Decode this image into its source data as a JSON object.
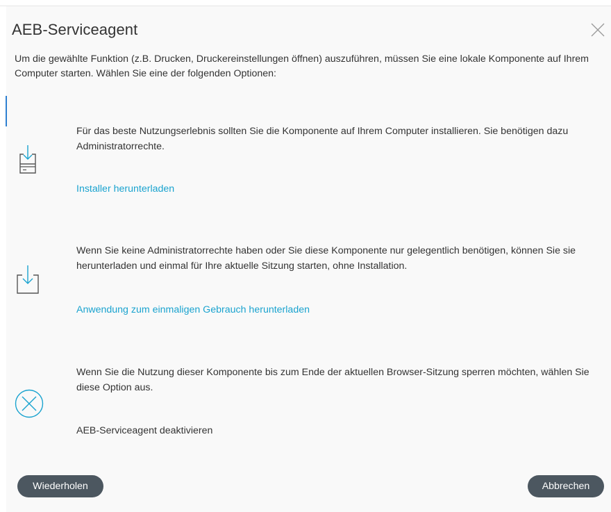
{
  "dialog": {
    "title": "AEB-Serviceagent",
    "intro": "Um die gewählte Funktion (z.B. Drucken, Druckereinstellungen öffnen) auszuführen, müssen Sie eine lokale Komponente auf Ihrem Computer starten. Wählen Sie eine der folgenden Optionen:"
  },
  "options": [
    {
      "icon": "install-disk-icon",
      "text": "Für das beste Nutzungserlebnis sollten Sie die Komponente auf Ihrem Computer installieren. Sie benötigen dazu Administratorrechte.",
      "action": "Installer herunterladen"
    },
    {
      "icon": "download-tray-icon",
      "text": "Wenn Sie keine Administratorrechte haben oder Sie diese Komponente nur gelegentlich benötigen, können Sie sie herunterladen und einmal für Ihre aktuelle Sitzung starten, ohne Installation.",
      "action": "Anwendung zum einmaligen Gebrauch herunterladen"
    },
    {
      "icon": "circle-x-icon",
      "text": "Wenn Sie die Nutzung dieser Komponente bis zum Ende der aktuellen Browser-Sitzung sperren möchten, wählen Sie diese Option aus.",
      "action": "AEB-Serviceagent deaktivieren"
    }
  ],
  "buttons": {
    "retry": "Wiederholen",
    "cancel": "Abbrechen"
  },
  "colors": {
    "link": "#1aa3cf",
    "button_bg": "#4c5760",
    "dialog_bg": "#f9f9f9",
    "accent": "#2d7fd0"
  }
}
